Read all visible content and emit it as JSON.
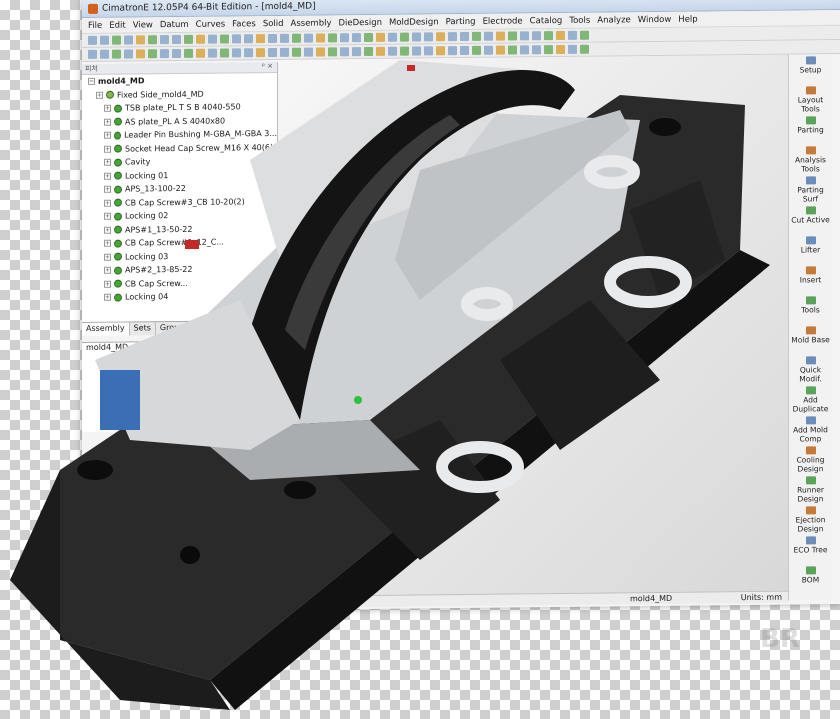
{
  "window": {
    "title": "CimatronE 12.05P4  64-Bit Edition - [mold4_MD]"
  },
  "menu": [
    "File",
    "Edit",
    "View",
    "Datum",
    "Curves",
    "Faces",
    "Solid",
    "Assembly",
    "DieDesign",
    "MoldDesign",
    "Parting",
    "Electrode",
    "Catalog",
    "Tools",
    "Analyze",
    "Window",
    "Help"
  ],
  "tree": {
    "header_label": "피처",
    "root": "mold4_MD",
    "items": [
      {
        "label": "Fixed Side_mold4_MD",
        "level": 1
      },
      {
        "label": "TSB plate_PL T S B 4040-550",
        "level": 2
      },
      {
        "label": "AS plate_PL A S 4040x80",
        "level": 2
      },
      {
        "label": "Leader Pin Bushing M-GBA_M-GBA 3...",
        "level": 2
      },
      {
        "label": "Socket Head Cap Screw_M16 X 40(6)",
        "level": 2
      },
      {
        "label": "Cavity",
        "level": 2
      },
      {
        "label": "Locking 01",
        "level": 2
      },
      {
        "label": "APS_13-100-22",
        "level": 2
      },
      {
        "label": "CB Cap Screw#3_CB 10-20(2)",
        "level": 2
      },
      {
        "label": "Locking 02",
        "level": 2
      },
      {
        "label": "APS#1_13-50-22",
        "level": 2
      },
      {
        "label": "CB Cap Screw#1_12_C...",
        "level": 2
      },
      {
        "label": "Locking 03",
        "level": 2
      },
      {
        "label": "APS#2_13-85-22",
        "level": 2
      },
      {
        "label": "CB Cap Screw...",
        "level": 2
      },
      {
        "label": "Locking 04",
        "level": 2
      }
    ],
    "tabs": [
      "Assembly",
      "Sets",
      "Groups"
    ]
  },
  "tree2": {
    "root": "mold4_MD"
  },
  "tools": [
    "Setup",
    "Layout Tools",
    "Parting",
    "Analysis Tools",
    "Parting Surf",
    "Cut Active",
    "Lifter",
    "Insert",
    "Tools",
    "Mold Base",
    "Quick Modif.",
    "Add Duplicate",
    "Add Mold Comp",
    "Cooling Design",
    "Runner Design",
    "Ejection Design",
    "ECO Tree",
    "BOM"
  ],
  "status": {
    "doc": "mold4_MD",
    "units": "Units: mm"
  },
  "watermark": "BR",
  "colors": {
    "titlebar": "#c6d6ea",
    "panel": "#f2f2f2",
    "model_base": "#2a2a2a",
    "model_plate": "#cfd2d4",
    "part_bumper": "#141414"
  }
}
